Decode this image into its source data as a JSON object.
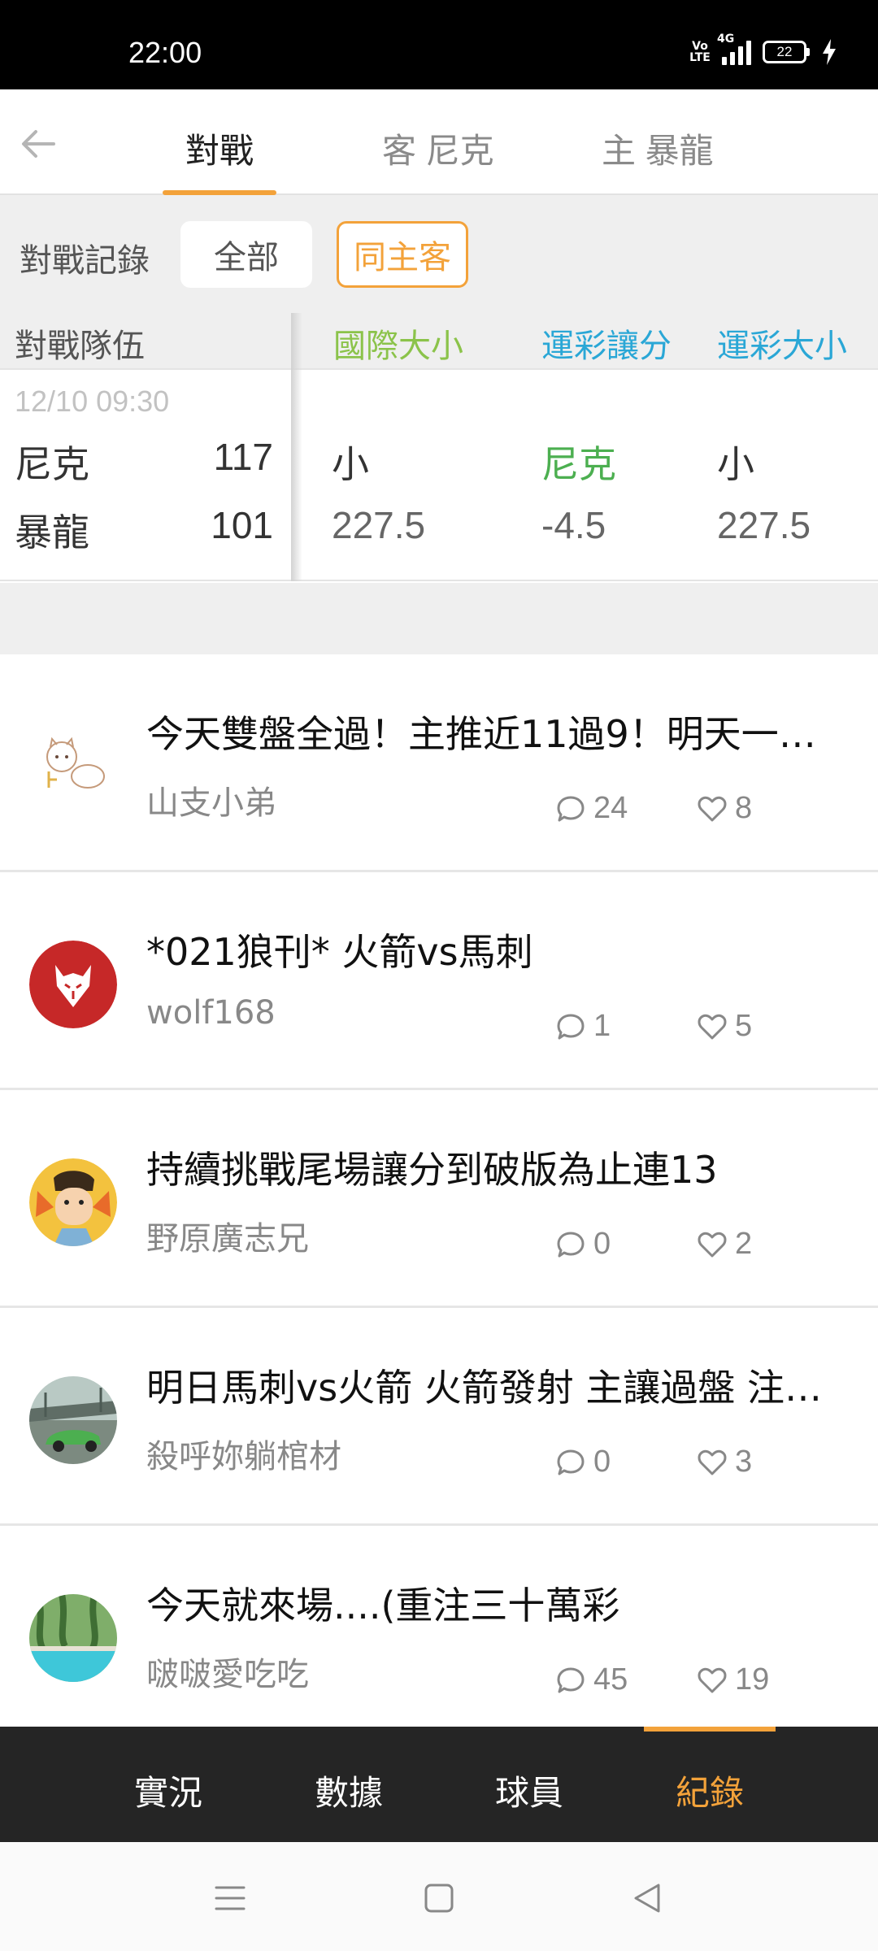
{
  "status_bar": {
    "time": "22:00",
    "volte": "Vo LTE",
    "network": "4G",
    "battery": "22"
  },
  "top_nav": {
    "tabs": [
      {
        "label": "對戰",
        "active": true
      },
      {
        "label": "客 尼克",
        "active": false
      },
      {
        "label": "主 暴龍",
        "active": false
      }
    ]
  },
  "filter": {
    "label": "對戰記錄",
    "chips": [
      {
        "label": "全部",
        "selected": false
      },
      {
        "label": "同主客",
        "selected": true
      }
    ]
  },
  "table": {
    "headers": {
      "teams": "對戰隊伍",
      "intl_ou": "國際大小",
      "spread": "運彩讓分",
      "ou": "運彩大小"
    },
    "rows": [
      {
        "date": "12/10 09:30",
        "away_team": "尼克",
        "away_score": "117",
        "home_team": "暴龍",
        "home_score": "101",
        "intl_result": "小",
        "intl_line": "227.5",
        "spread_result": "尼克",
        "spread_line": "-4.5",
        "ou_result": "小",
        "ou_line": "227.5"
      }
    ]
  },
  "posts": [
    {
      "title": "今天雙盤全過！主推近11過9！明天一樣…",
      "author": "山支小弟",
      "comments": "24",
      "likes": "8",
      "avatar": "cat-sketch"
    },
    {
      "title": "*021狼刊* 火箭vs馬刺",
      "author": "wolf168",
      "comments": "1",
      "likes": "5",
      "avatar": "wolf-logo"
    },
    {
      "title": "持續挑戰尾場讓分到破版為止連13",
      "author": "野原廣志兄",
      "comments": "0",
      "likes": "2",
      "avatar": "cartoon-man"
    },
    {
      "title": "明日馬刺vs火箭 火箭發射 主讓過盤 注…",
      "author": "殺呼妳躺棺材",
      "comments": "0",
      "likes": "3",
      "avatar": "green-car"
    },
    {
      "title": "今天就來場....(重注三十萬彩",
      "author": "啵啵愛吃吃",
      "comments": "45",
      "likes": "19",
      "avatar": "pool"
    }
  ],
  "bottom_nav": {
    "items": [
      {
        "label": "實況"
      },
      {
        "label": "數據"
      },
      {
        "label": "球員"
      },
      {
        "label": "紀錄"
      }
    ],
    "active_index": 3
  },
  "colors": {
    "accent": "#f3a23a",
    "intl_header": "#8bc34a",
    "lottery_header": "#2aa7d6",
    "win_team": "#4caf50"
  }
}
